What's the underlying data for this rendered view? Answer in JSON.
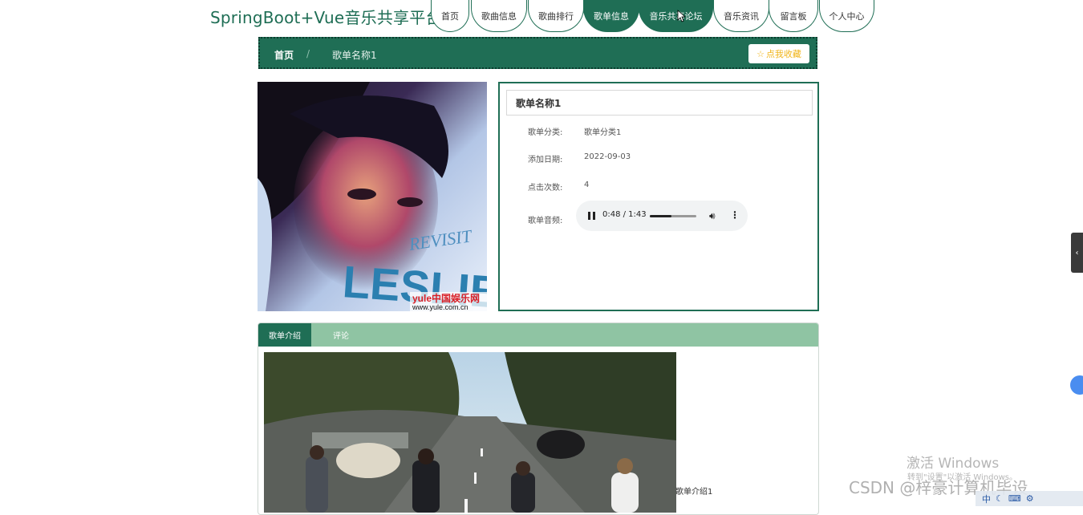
{
  "app": {
    "title": "SpringBoot+Vue音乐共享平台"
  },
  "nav": {
    "items": [
      {
        "label": "首页",
        "active": false
      },
      {
        "label": "歌曲信息",
        "active": false
      },
      {
        "label": "歌曲排行",
        "active": false
      },
      {
        "label": "歌单信息",
        "active": true
      },
      {
        "label": "音乐共享论坛",
        "active": true
      },
      {
        "label": "音乐资讯",
        "active": false
      },
      {
        "label": "留言板",
        "active": false
      },
      {
        "label": "个人中心",
        "active": false
      }
    ]
  },
  "breadcrumb": {
    "home": "首页",
    "separator": "/",
    "current": "歌单名称1"
  },
  "favorite_button": {
    "icon": "star-outline-icon",
    "label": "点我收藏"
  },
  "cover": {
    "text_top": "REVISIT",
    "text_main": "LESLIE",
    "brand": "yule中国娱乐网",
    "url": "www.yule.com.cn"
  },
  "details": {
    "title": "歌单名称1",
    "category_label": "歌单分类:",
    "category_value": "歌单分类1",
    "date_label": "添加日期:",
    "date_value": "2022-09-03",
    "clicks_label": "点击次数:",
    "clicks_value": "4",
    "audio_label": "歌单音频:"
  },
  "audio": {
    "time": "0:48 / 1:43",
    "progress": 0.466
  },
  "tabs": {
    "intro": "歌单介绍",
    "comments": "评论"
  },
  "intro": {
    "text": "歌单介绍1"
  },
  "overlay": {
    "activate_title": "激活 Windows",
    "activate_sub": "转到\"设置\"以激活 Windows。",
    "csdn": "CSDN @梓豪计算机毕设",
    "ime": "中"
  },
  "colors": {
    "primary": "#1f6e55",
    "tab_bar": "#8fc4a3",
    "star": "#f0b51a"
  }
}
